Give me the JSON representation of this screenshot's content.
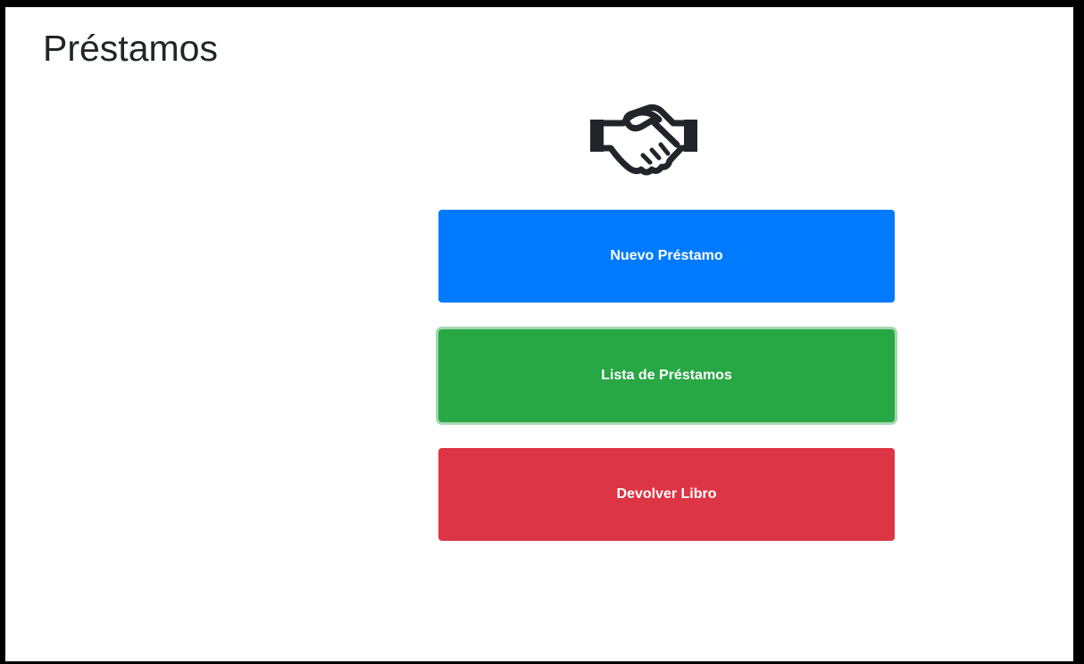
{
  "page": {
    "title": "Préstamos"
  },
  "hero": {
    "icon": "handshake-icon"
  },
  "actions": {
    "new_loan": "Nuevo Préstamo",
    "loan_list": "Lista de Préstamos",
    "return_book": "Devolver Libro"
  },
  "colors": {
    "primary": "#007bff",
    "success": "#28a745",
    "danger": "#dc3545",
    "text": "#212529"
  }
}
